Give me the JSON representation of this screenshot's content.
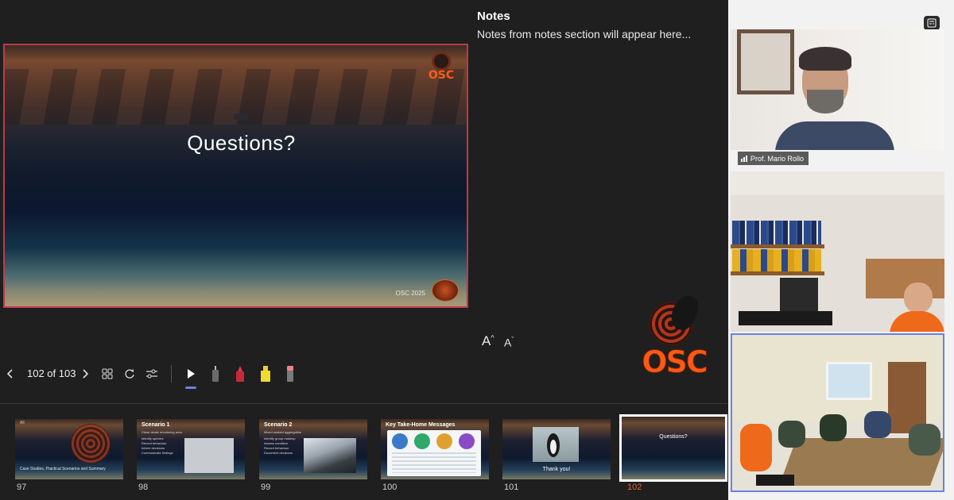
{
  "notes": {
    "title": "Notes",
    "placeholder": "Notes from notes section will appear here..."
  },
  "slide": {
    "title": "Questions?",
    "footer": "OSC 2025",
    "logo_text": "OSC"
  },
  "font_controls": {
    "increase_label": "A",
    "decrease_label": "A"
  },
  "logo": {
    "text": "OSC"
  },
  "navigation": {
    "counter": "102 of 103"
  },
  "tools": [
    "pointer",
    "pen",
    "marker",
    "highlighter",
    "eraser"
  ],
  "thumbnails": [
    {
      "number": "97",
      "title": "",
      "subtitle": "Case Studies, Practical Scenarios and Summary",
      "tag": "All"
    },
    {
      "number": "98",
      "title": "Scenario 1",
      "subtitle": "Close whale monitoring area",
      "bullets": "Identify species\nRecord behaviour\nInform decisions\nCommunicate findings"
    },
    {
      "number": "99",
      "title": "Scenario 2",
      "subtitle": "Mixed seabird aggregation",
      "bullets": "Identify group makeup\nAssess condition\nRecord behaviour\nDocument decisions"
    },
    {
      "number": "100",
      "title": "Key Take-Home Messages"
    },
    {
      "number": "101",
      "caption": "Thank you!"
    },
    {
      "number": "102",
      "center": "Questions?"
    }
  ],
  "participants": [
    {
      "name": "Prof. Mario Rollo"
    },
    {
      "name": ""
    },
    {
      "name": ""
    }
  ],
  "colors": {
    "accent": "#6e7fe3",
    "slide_border": "#c0394b",
    "active_number": "#e0642a",
    "logo_orange": "#ff5a14"
  }
}
